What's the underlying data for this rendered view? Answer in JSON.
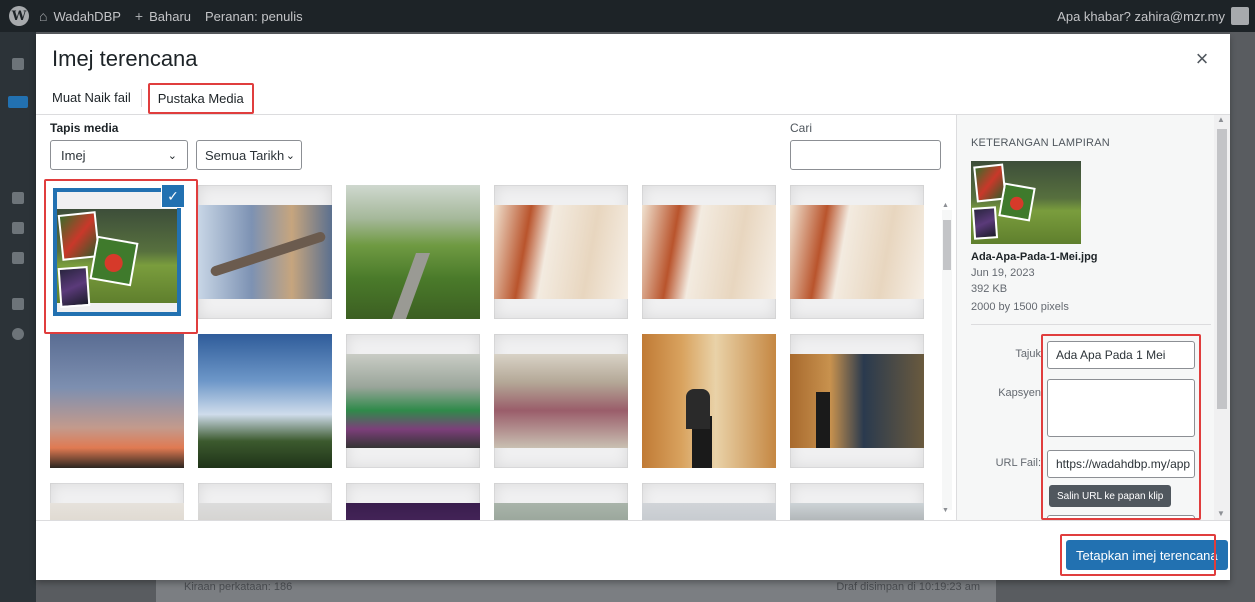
{
  "admin_bar": {
    "site_name": "WadahDBP",
    "new_label": "Baharu",
    "role_label": "Peranan: penulis",
    "greeting": "Apa khabar? zahira@mzr.my"
  },
  "background_panel": {
    "word_count": "Kiraan perkataan: 186",
    "draft_status": "Draf disimpan di 10:19:23 am"
  },
  "modal": {
    "title": "Imej terencana",
    "close_label": "×",
    "tabs": [
      {
        "label": "Muat Naik fail",
        "active": false
      },
      {
        "label": "Pustaka Media",
        "active": true
      }
    ],
    "filter": {
      "label": "Tapis media",
      "type_value": "Imej",
      "date_value": "Semua Tarikh"
    },
    "search": {
      "label": "Cari",
      "value": ""
    },
    "media_items": [
      {
        "name": "Ada-Apa-Pada-1-Mei",
        "selected": true
      },
      {
        "name": "branch",
        "selected": false
      },
      {
        "name": "winding-road",
        "selected": false
      },
      {
        "name": "book-pages-1",
        "selected": false
      },
      {
        "name": "book-pages-2",
        "selected": false
      },
      {
        "name": "book-pages-3",
        "selected": false
      },
      {
        "name": "dusk-sky",
        "selected": false
      },
      {
        "name": "blue-sky",
        "selected": false
      },
      {
        "name": "group-photo",
        "selected": false
      },
      {
        "name": "seminar-hall",
        "selected": false
      },
      {
        "name": "speaker-podium",
        "selected": false
      },
      {
        "name": "stage-speech",
        "selected": false
      }
    ],
    "attachment": {
      "heading": "KETERANGAN LAMPIRAN",
      "filename": "Ada-Apa-Pada-1-Mei.jpg",
      "date": "Jun 19, 2023",
      "size": "392 KB",
      "dimensions": "2000 by 1500 pixels",
      "fields": {
        "title_label": "Tajuk",
        "title_value": "Ada Apa Pada 1 Mei",
        "caption_label": "Kapsyen",
        "caption_value": "",
        "url_label": "URL Fail:",
        "url_value": "https://wadahdbp.my/app"
      },
      "copy_button": "Salin URL ke papan klip"
    },
    "primary_button": "Tetapkan imej terencana"
  },
  "colors": {
    "accent": "#2271b1",
    "highlight": "#e03d3d",
    "admin_bar": "#1d2327"
  }
}
